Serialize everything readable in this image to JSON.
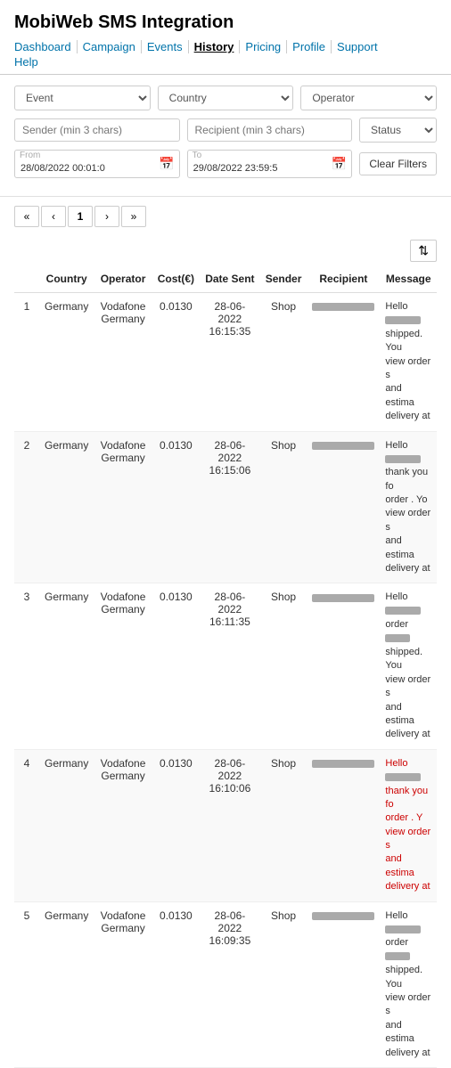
{
  "app": {
    "title": "MobiWeb SMS Integration"
  },
  "nav": {
    "items": [
      {
        "label": "Dashboard",
        "active": false
      },
      {
        "label": "Campaign",
        "active": false
      },
      {
        "label": "Events",
        "active": false
      },
      {
        "label": "History",
        "active": true
      },
      {
        "label": "Pricing",
        "active": false
      },
      {
        "label": "Profile",
        "active": false
      },
      {
        "label": "Support",
        "active": false
      }
    ],
    "row2": [
      {
        "label": "Help",
        "active": false
      }
    ]
  },
  "filters": {
    "event_placeholder": "Event",
    "country_placeholder": "Country",
    "operator_placeholder": "Operator",
    "sender_placeholder": "Sender (min 3 chars)",
    "recipient_placeholder": "Recipient (min 3 chars)",
    "status_placeholder": "Status",
    "from_label": "From",
    "from_value": "28/08/2022 00:01:0",
    "to_label": "To",
    "to_value": "29/08/2022 23:59:5",
    "clear_label": "Clear Filters"
  },
  "pagination": {
    "first": "«",
    "prev": "‹",
    "page": "1",
    "next": "›",
    "last": "»"
  },
  "table": {
    "sort_icon": "⇅",
    "columns": [
      "",
      "Country",
      "Operator",
      "Cost(€)",
      "Date Sent",
      "Sender",
      "Recipient",
      "Message"
    ],
    "rows": [
      {
        "num": "1",
        "country": "Germany",
        "operator": "Vodafone Germany",
        "cost": "0.0130",
        "date": "28-06-2022",
        "time": "16:15:35",
        "sender": "Shop",
        "recipient_width": 70,
        "msg_color": "normal",
        "msg_lines": [
          "Hello ",
          " shipped. You",
          "view order s",
          "and estima",
          "delivery at "
        ]
      },
      {
        "num": "2",
        "country": "Germany",
        "operator": "Vodafone Germany",
        "cost": "0.0130",
        "date": "28-06-2022",
        "time": "16:15:06",
        "sender": "Shop",
        "recipient_width": 70,
        "msg_color": "normal",
        "msg_lines": [
          "Hello ",
          " thank you fo",
          "order . Yo",
          "view order s",
          "and estima",
          "delivery at "
        ]
      },
      {
        "num": "3",
        "country": "Germany",
        "operator": "Vodafone Germany",
        "cost": "0.0130",
        "date": "28-06-2022",
        "time": "16:11:35",
        "sender": "Shop",
        "recipient_width": 70,
        "msg_color": "normal",
        "msg_lines": [
          "Hello ",
          " order ",
          "shipped. You",
          "view order s",
          "and estima",
          "delivery at "
        ]
      },
      {
        "num": "4",
        "country": "Germany",
        "operator": "Vodafone Germany",
        "cost": "0.0130",
        "date": "28-06-2022",
        "time": "16:10:06",
        "sender": "Shop",
        "recipient_width": 70,
        "msg_color": "red",
        "msg_lines": [
          "Hello ",
          " thank you fo",
          "order . Y",
          "view order s",
          "and estima",
          "delivery at "
        ]
      },
      {
        "num": "5",
        "country": "Germany",
        "operator": "Vodafone Germany",
        "cost": "0.0130",
        "date": "28-06-2022",
        "time": "16:09:35",
        "sender": "Shop",
        "recipient_width": 70,
        "msg_color": "normal",
        "msg_lines": [
          "Hello ",
          " order ",
          "shipped. You",
          "view order s",
          "and estima",
          "delivery at "
        ]
      }
    ]
  }
}
